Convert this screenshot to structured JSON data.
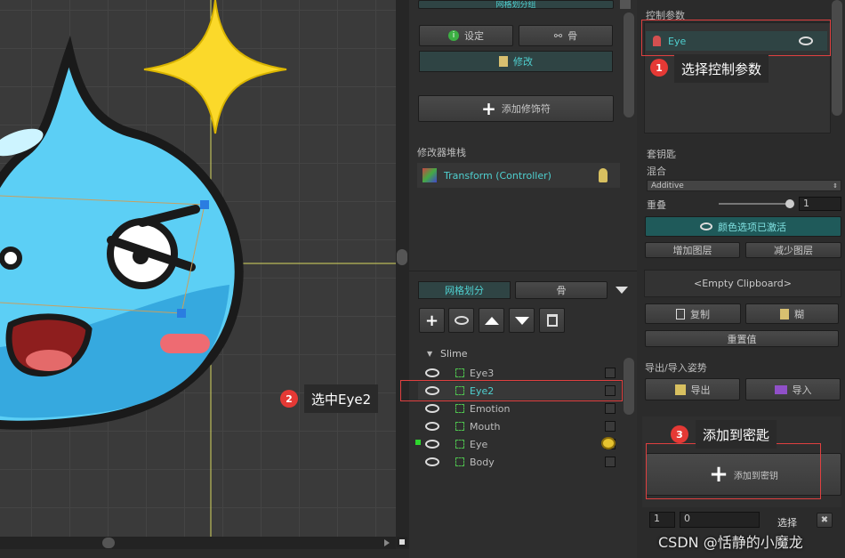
{
  "viewport": {
    "guide_color": "#e8e85a"
  },
  "modifier_section": {
    "header_tab": "网格划分组",
    "settings_button": "设定",
    "bone_button": "骨",
    "modify_label": "修改",
    "add_modifier_button": "添加修饰符",
    "stack_label": "修改器堆栈",
    "stack_items": [
      {
        "label": "Transform (Controller)"
      }
    ]
  },
  "mesh_section": {
    "tab_mesh": "网格划分",
    "tab_bone": "骨",
    "tree_root": "Slime",
    "items": [
      {
        "label": "Eye3",
        "selected": false
      },
      {
        "label": "Eye2",
        "selected": true
      },
      {
        "label": "Emotion",
        "selected": false
      },
      {
        "label": "Mouth",
        "selected": false
      },
      {
        "label": "Eye",
        "selected": false
      },
      {
        "label": "Body",
        "selected": false
      }
    ]
  },
  "right_panel": {
    "control_params_label": "控制参数",
    "control_param_item": "Eye",
    "keyset_label": "套钥匙",
    "blend_label": "混合",
    "blend_value": "Additive",
    "weight_label": "重叠",
    "weight_value": "1",
    "color_option_button": "颜色选项已激活",
    "add_layer_button": "增加图层",
    "remove_layer_button": "减少图层",
    "clipboard_label": "<Empty Clipboard>",
    "copy_button": "复制",
    "paste_button": "糊",
    "reset_button": "重置值",
    "pose_label": "导出/导入姿势",
    "export_button": "导出",
    "import_button": "导入",
    "add_to_key_button": "添加到密钥",
    "bottom_field_1": "1",
    "bottom_field_2": "0",
    "select_button": "选择"
  },
  "annotations": {
    "step1_num": "1",
    "step1_text": "选择控制参数",
    "step2_num": "2",
    "step2_text": "选中Eye2",
    "step3_num": "3",
    "step3_text": "添加到密匙"
  },
  "watermark": "CSDN @恬静的小魔龙",
  "colors": {
    "accent_teal": "#4fd0d0",
    "annotation_red": "#e53935",
    "selection_box": "#e04040",
    "slime_blue": "#4cc3ef"
  }
}
